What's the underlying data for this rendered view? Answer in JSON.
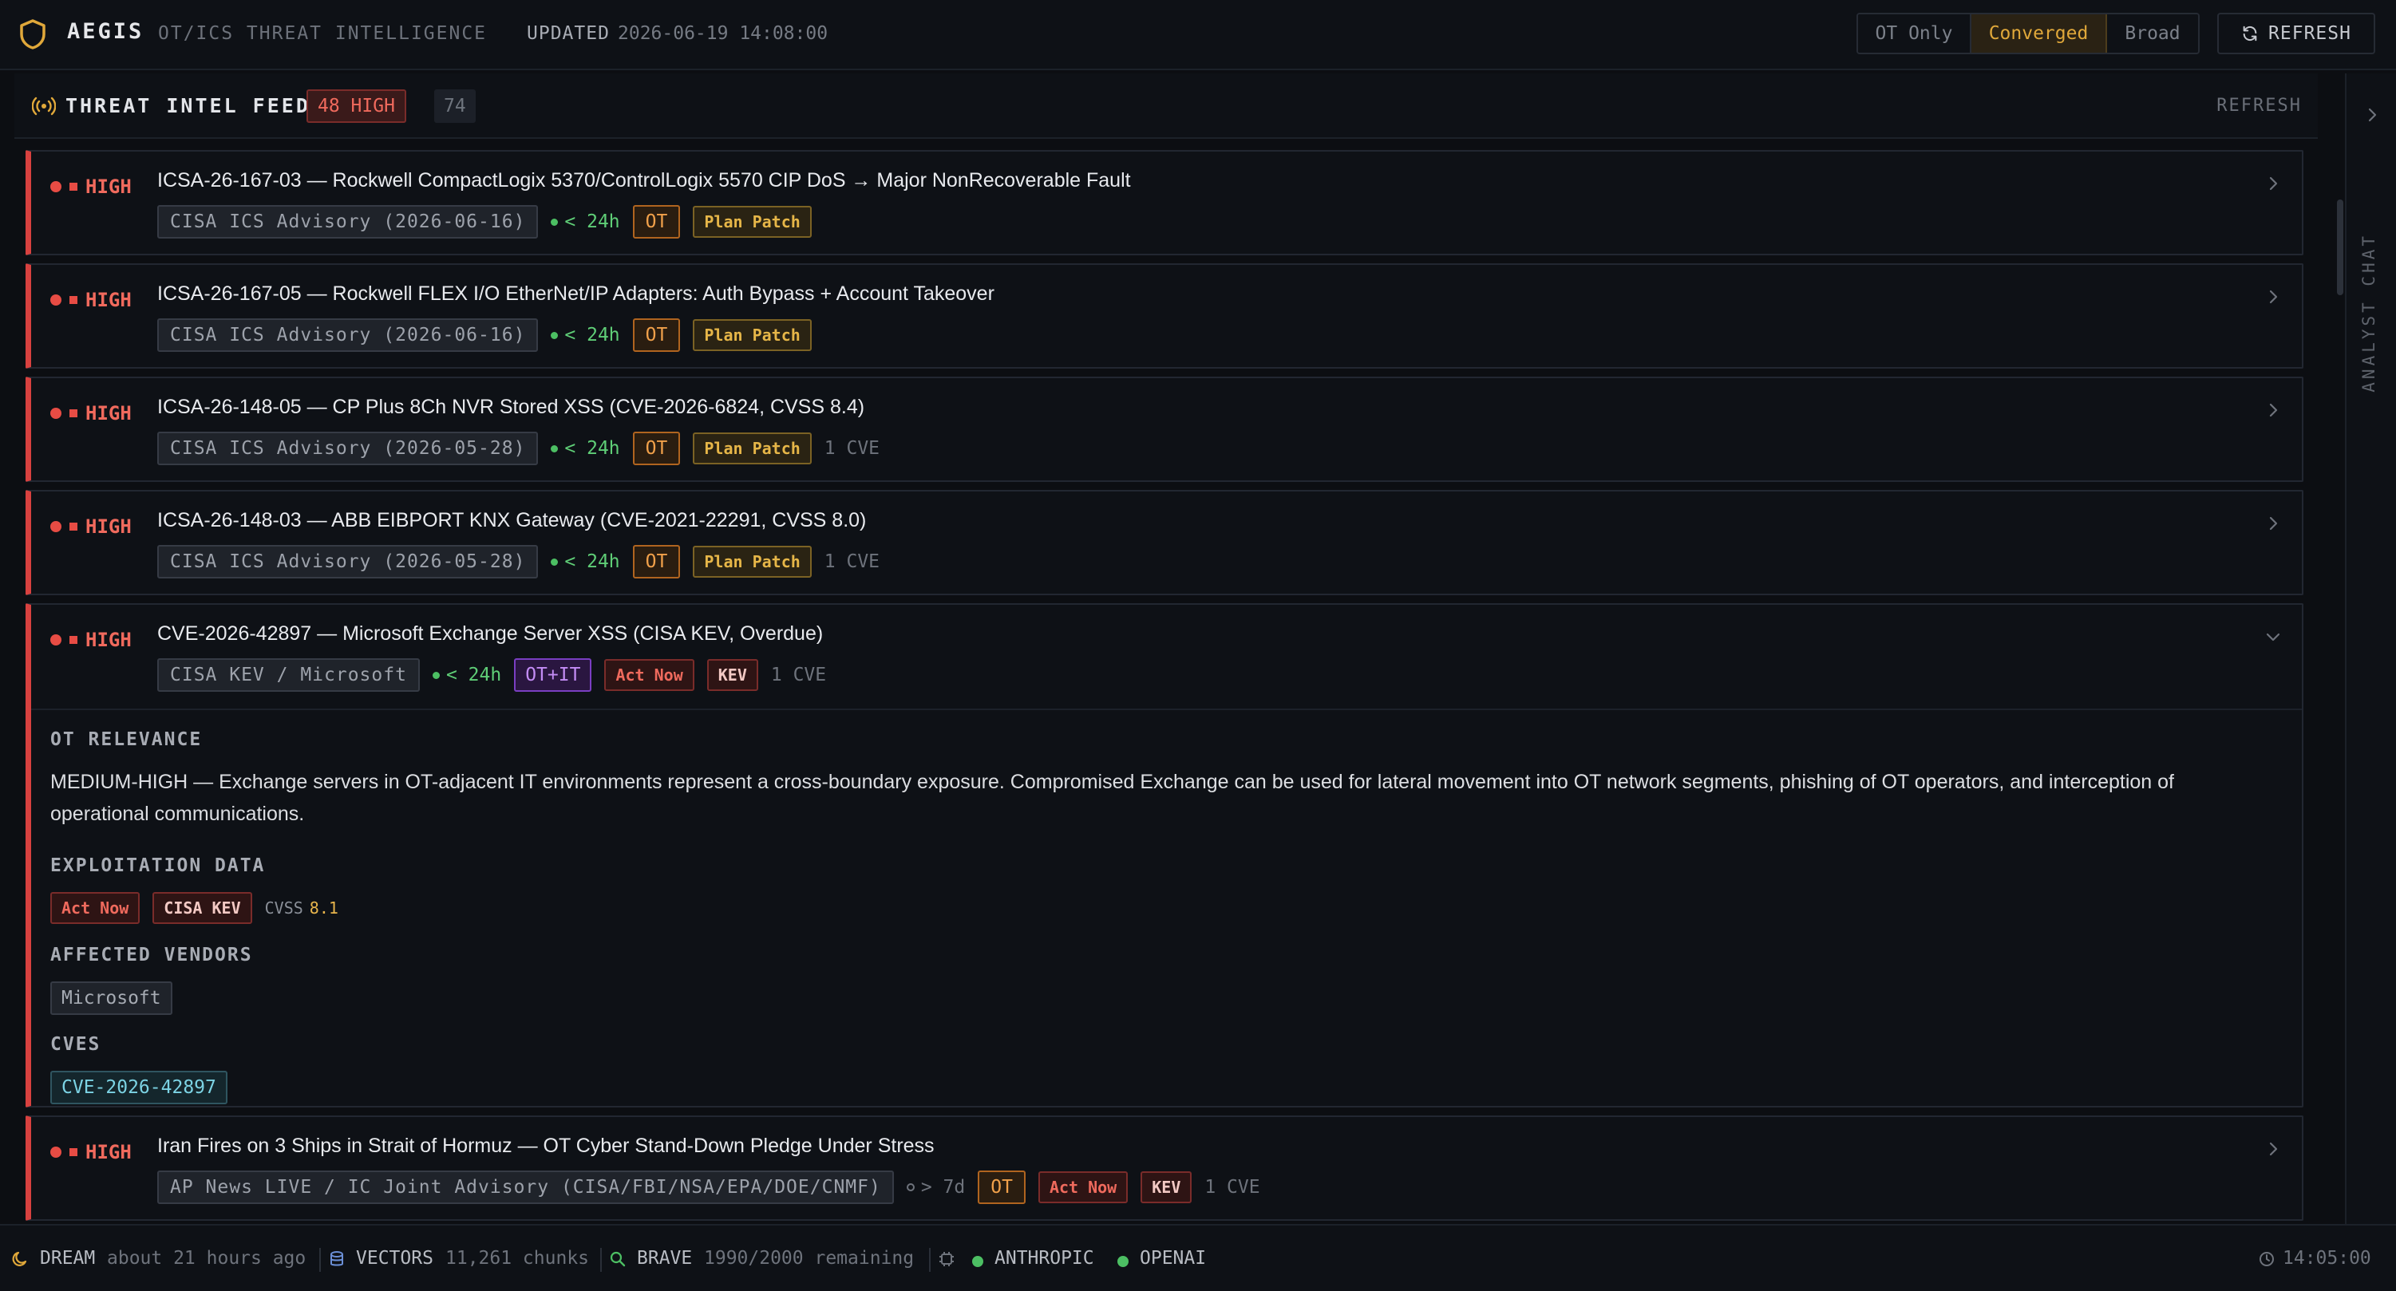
{
  "app": {
    "brand": "AEGIS",
    "subtitle": "OT/ICS THREAT INTELLIGENCE",
    "updated_label": "UPDATED",
    "updated_value": "2026-06-19 14:08:00",
    "modes": [
      "OT Only",
      "Converged",
      "Broad"
    ],
    "active_mode": "Converged",
    "refresh_label": "REFRESH"
  },
  "colors": {
    "accent": "#e0a83a",
    "high": "#f06a5d",
    "ot": "#f0a04a",
    "otit": "#c38cf5",
    "fresh": "#5fce77"
  },
  "feed": {
    "title": "THREAT INTEL FEED",
    "high_badge": "48 HIGH",
    "total_badge": "74",
    "refresh_label": "REFRESH",
    "items": [
      {
        "severity": "HIGH",
        "title": "ICSA-26-167-03 — Rockwell CompactLogix 5370/ControlLogix 5570 CIP DoS → Major NonRecoverable Fault",
        "source": "CISA ICS Advisory (2026-06-16)",
        "freshness": "< 24h",
        "scope": "OT",
        "action": "Plan Patch"
      },
      {
        "severity": "HIGH",
        "title": "ICSA-26-167-05 — Rockwell FLEX I/O EtherNet/IP Adapters: Auth Bypass + Account Takeover",
        "source": "CISA ICS Advisory (2026-06-16)",
        "freshness": "< 24h",
        "scope": "OT",
        "action": "Plan Patch"
      },
      {
        "severity": "HIGH",
        "title": "ICSA-26-148-05 — CP Plus 8Ch NVR Stored XSS (CVE-2026-6824, CVSS 8.4)",
        "source": "CISA ICS Advisory (2026-05-28)",
        "freshness": "< 24h",
        "scope": "OT",
        "action": "Plan Patch",
        "cve_count": "1 CVE"
      },
      {
        "severity": "HIGH",
        "title": "ICSA-26-148-03 — ABB EIBPORT KNX Gateway (CVE-2021-22291, CVSS 8.0)",
        "source": "CISA ICS Advisory (2026-05-28)",
        "freshness": "< 24h",
        "scope": "OT",
        "action": "Plan Patch",
        "cve_count": "1 CVE"
      },
      {
        "severity": "HIGH",
        "title": "CVE-2026-42897 — Microsoft Exchange Server XSS (CISA KEV, Overdue)",
        "source": "CISA KEV / Microsoft",
        "freshness": "< 24h",
        "scope": "OT+IT",
        "action": "Act Now",
        "kev": "KEV",
        "cve_count": "1 CVE",
        "detail": {
          "relevance_label": "OT RELEVANCE",
          "relevance_text": "MEDIUM-HIGH — Exchange servers in OT-adjacent IT environments represent a cross-boundary exposure. Compromised Exchange can be used for lateral movement into OT network segments, phishing of OT operators, and interception of operational communications.",
          "exploitation_label": "EXPLOITATION DATA",
          "exploitation_action": "Act Now",
          "exploitation_kev": "CISA KEV",
          "cvss_label": "CVSS",
          "cvss_value": "8.1",
          "vendors_label": "AFFECTED VENDORS",
          "vendor": "Microsoft",
          "cves_label": "CVES",
          "cve": "CVE-2026-42897"
        }
      },
      {
        "severity": "HIGH",
        "title": "Iran Fires on 3 Ships in Strait of Hormuz — OT Cyber Stand-Down Pledge Under Stress",
        "source": "AP News LIVE / IC Joint Advisory (CISA/FBI/NSA/EPA/DOE/CNMF)",
        "freshness": "> 7d",
        "scope": "OT",
        "action": "Act Now",
        "kev": "KEV",
        "cve_count": "1 CVE"
      }
    ]
  },
  "rail": {
    "label": "ANALYST CHAT"
  },
  "status": {
    "dream_label": "DREAM",
    "dream_value": "about 21 hours ago",
    "vectors_label": "VECTORS",
    "vectors_value": "11,261 chunks",
    "brave_label": "BRAVE",
    "brave_value": "1990/2000 remaining",
    "provider1": "ANTHROPIC",
    "provider2": "OPENAI",
    "clock": "14:05:00"
  }
}
